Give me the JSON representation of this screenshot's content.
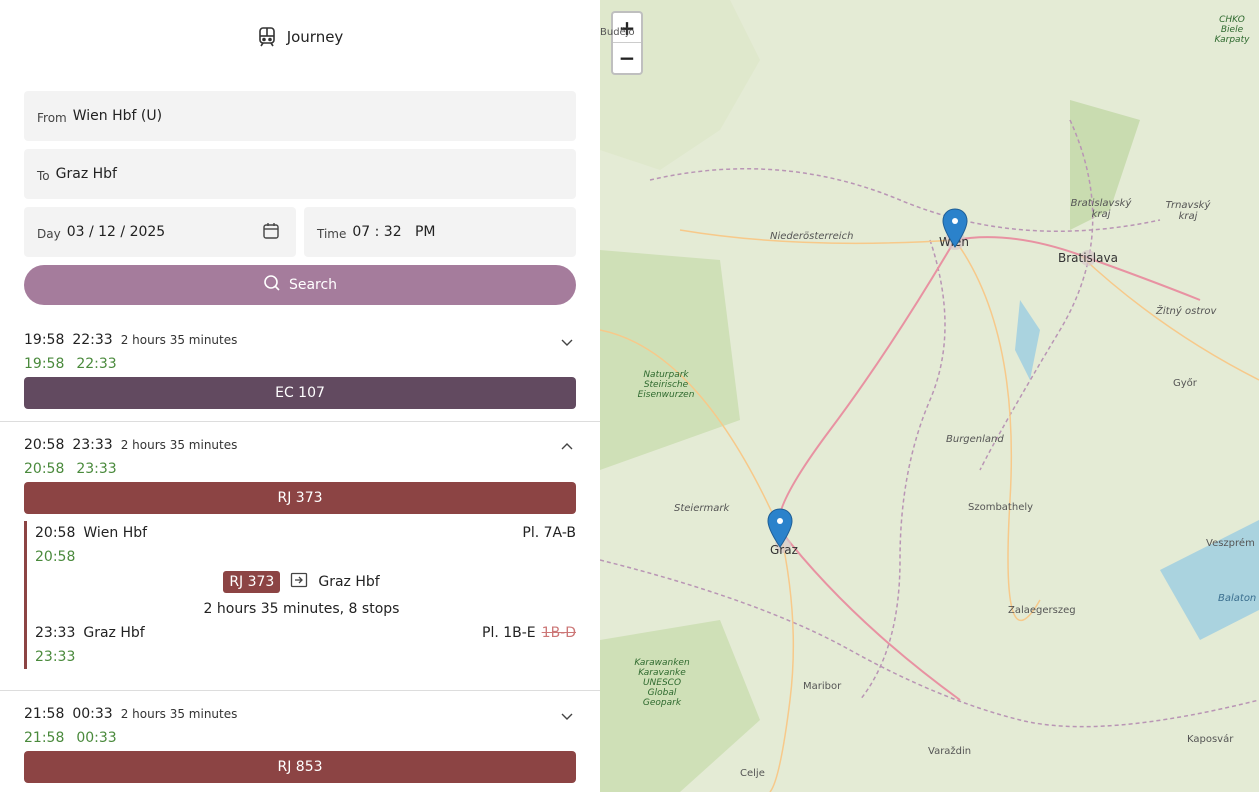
{
  "header": {
    "title": "Journey",
    "icon": "train-icon"
  },
  "form": {
    "from_label": "From",
    "from_value": "Wien Hbf (U)",
    "to_label": "To",
    "to_value": "Graz Hbf",
    "day_label": "Day",
    "day_value": "03 / 12 / 2025",
    "time_label": "Time",
    "time_value": "07 : 32   PM",
    "search_label": "Search"
  },
  "journeys": [
    {
      "dep": "19:58",
      "arr": "22:33",
      "duration": "2 hours 35 minutes",
      "rt_dep": "19:58",
      "rt_arr": "22:33",
      "train": "EC 107",
      "color": "#624a60",
      "expanded": false
    },
    {
      "dep": "20:58",
      "arr": "23:33",
      "duration": "2 hours 35 minutes",
      "rt_dep": "20:58",
      "rt_arr": "23:33",
      "train": "RJ 373",
      "color": "#8c4444",
      "expanded": true
    },
    {
      "dep": "21:58",
      "arr": "00:33",
      "duration": "2 hours 35 minutes",
      "rt_dep": "21:58",
      "rt_arr": "00:33",
      "train": "RJ 853",
      "color": "#8c4444",
      "expanded": false
    }
  ],
  "detail": {
    "dep_time": "20:58",
    "dep_station": "Wien Hbf",
    "dep_platform": "Pl. 7A-B",
    "dep_rt": "20:58",
    "train": "RJ 373",
    "direction": "Graz Hbf",
    "summary": "2 hours 35 minutes, 8 stops",
    "arr_time": "23:33",
    "arr_station": "Graz Hbf",
    "arr_platform": "Pl. 1B-E",
    "arr_platform_old": "1B-D",
    "arr_rt": "23:33"
  },
  "map": {
    "zoom_in": "+",
    "zoom_out": "−",
    "places": [
      {
        "name": "Wien"
      },
      {
        "name": "Graz"
      },
      {
        "name": "Bratislava"
      },
      {
        "name": "Szombathely"
      },
      {
        "name": "Maribor"
      },
      {
        "name": "Zalaegerszeg"
      },
      {
        "name": "Győr"
      },
      {
        "name": "Veszprém"
      },
      {
        "name": "Kaposvár"
      },
      {
        "name": "Varaždin"
      },
      {
        "name": "Celje"
      },
      {
        "name": "Žitný ostrov"
      },
      {
        "name": "Niederösterreich"
      },
      {
        "name": "Burgenland"
      },
      {
        "name": "Steiermark"
      },
      {
        "name": "Bratislavský kraj"
      },
      {
        "name": "Trnavský kraj"
      },
      {
        "name": "Balaton"
      },
      {
        "name": "Naturpark Steirische Eisenwurzen"
      },
      {
        "name": "Karawanken Karavanke UNESCO Global Geopark"
      },
      {
        "name": "CHKO Biele Karpaty"
      },
      {
        "name": "Budějo"
      }
    ],
    "markers": [
      {
        "name": "Wien"
      },
      {
        "name": "Graz"
      }
    ]
  }
}
